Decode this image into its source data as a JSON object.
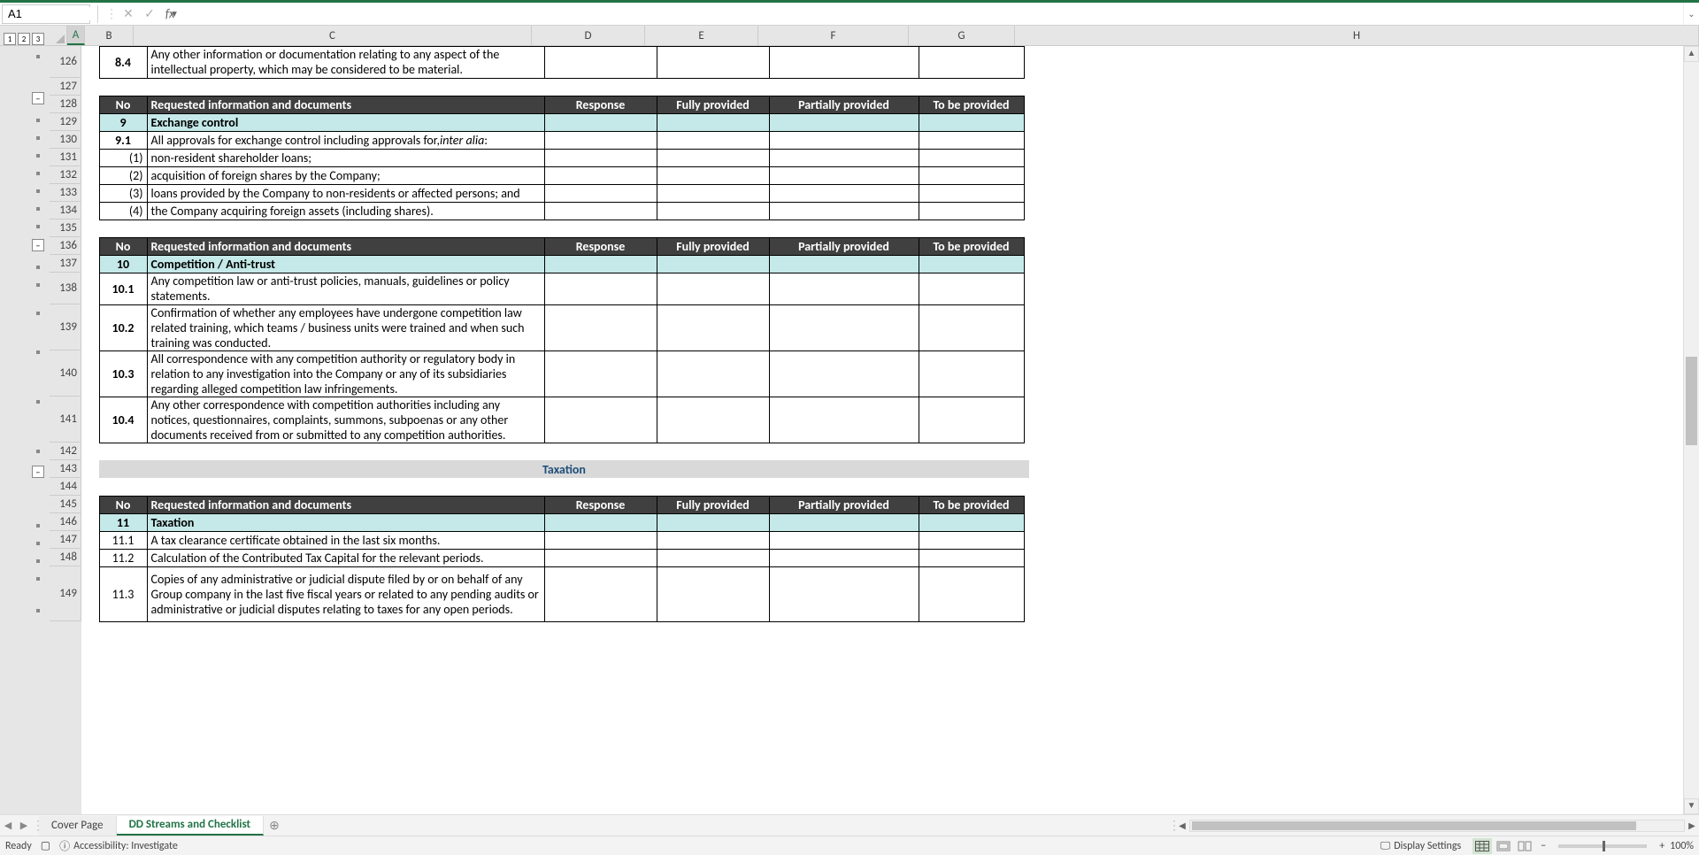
{
  "nameBox": "A1",
  "formula": "",
  "outlineLevels": [
    "1",
    "2",
    "3"
  ],
  "columns": [
    "A",
    "B",
    "C",
    "D",
    "E",
    "F",
    "G",
    "H"
  ],
  "rowNumbers": [
    126,
    127,
    128,
    129,
    130,
    131,
    132,
    133,
    134,
    135,
    136,
    137,
    138,
    139,
    140,
    141,
    142,
    143,
    144,
    145,
    146,
    147,
    148,
    149
  ],
  "tableHeaders": {
    "no": "No",
    "req": "Requested information and documents",
    "resp": "Response",
    "fully": "Fully provided",
    "partially": "Partially provided",
    "tobe": "To be provided"
  },
  "row84": {
    "no": "8.4",
    "text": "Any other information or documentation relating to any aspect of the intellectual property, which may be considered to be material."
  },
  "section9": {
    "no": "9",
    "title": "Exchange control",
    "row91": {
      "no": "9.1",
      "text_a": "All approvals for exchange control including approvals for, ",
      "text_i": "inter alia",
      "text_b": ":"
    },
    "sub1": {
      "no": "(1)",
      "text": "non-resident shareholder loans;"
    },
    "sub2": {
      "no": "(2)",
      "text": "acquisition of foreign shares by the Company;"
    },
    "sub3": {
      "no": "(3)",
      "text": "loans provided by the Company to non-residents or affected persons; and"
    },
    "sub4": {
      "no": "(4)",
      "text": "the Company acquiring foreign assets (including shares)."
    }
  },
  "section10": {
    "no": "10",
    "title": "Competition / Anti-trust",
    "row101": {
      "no": "10.1",
      "text": "Any competition law or anti-trust policies, manuals, guidelines or policy statements."
    },
    "row102": {
      "no": "10.2",
      "text": "Confirmation of whether any employees have undergone competition law related training, which teams / business units were trained and when such training was conducted."
    },
    "row103": {
      "no": "10.3",
      "text": " All correspondence with any competition authority or regulatory body in relation to any investigation into the Company or any of its subsidiaries regarding alleged competition law infringements."
    },
    "row104": {
      "no": "10.4",
      "text": " Any other correspondence with competition authorities including any notices, questionnaires, complaints, summons, subpoenas or any other documents received from or submitted to any competition authorities."
    }
  },
  "taxation": "Taxation",
  "section11": {
    "no": "11",
    "title": "Taxation",
    "row111": {
      "no": "11.1",
      "text": "A tax clearance certificate obtained in the last six months."
    },
    "row112": {
      "no": "11.2",
      "text": "Calculation of the Contributed Tax Capital for the relevant periods."
    },
    "row113": {
      "no": "11.3",
      "text": "Copies of any administrative or judicial dispute filed by or on behalf of any Group company in the last five fiscal years or related to any pending audits or administrative or judicial disputes relating to taxes for any open periods."
    }
  },
  "tabs": {
    "cover": "Cover Page",
    "dd": "DD Streams and Checklist"
  },
  "status": {
    "ready": "Ready",
    "access": "Accessibility: Investigate",
    "display": "Display Settings",
    "zoom": "100%"
  }
}
